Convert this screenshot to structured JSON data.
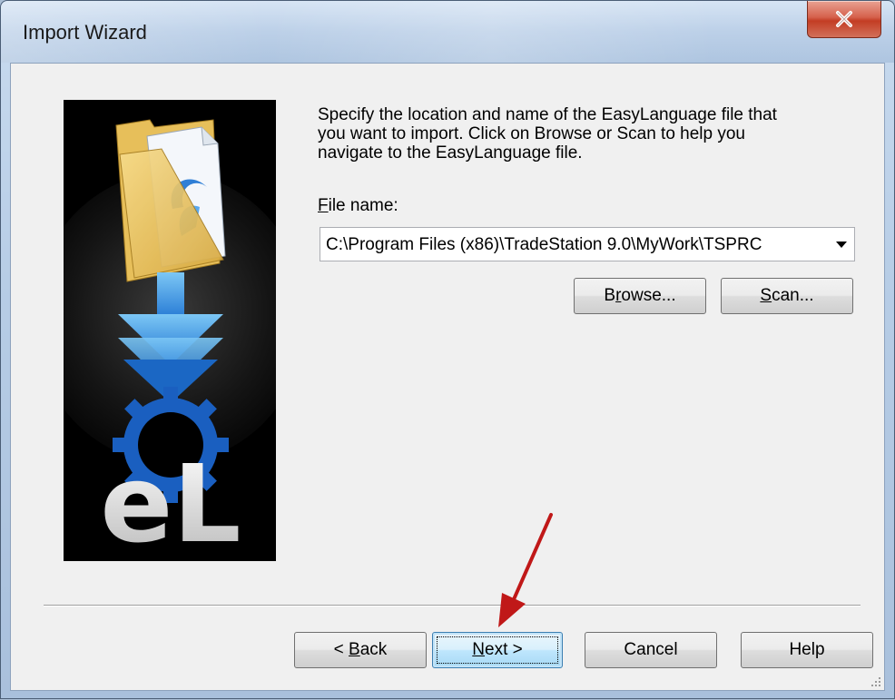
{
  "window": {
    "title": "Import Wizard"
  },
  "content": {
    "instructions": "Specify the location and name of the EasyLanguage file that\nyou want to import.  Click on Browse or Scan to help you\nnavigate to the EasyLanguage file.",
    "file_label_mnemonic": "F",
    "file_label_rest": "ile name:",
    "file_path": "C:\\Program Files (x86)\\TradeStation 9.0\\MyWork\\TSPRC"
  },
  "buttons": {
    "browse_pre": "B",
    "browse_mn": "r",
    "browse_post": "owse...",
    "scan_mn": "S",
    "scan_post": "can...",
    "back_pre": "< ",
    "back_mn": "B",
    "back_post": "ack",
    "next_mn": "N",
    "next_post": "ext >",
    "cancel": "Cancel",
    "help": "Help"
  },
  "image": {
    "logo_text": "eL"
  },
  "icons": {
    "close": "close-icon",
    "arrow": "red-arrow-annotation",
    "grip": "resize-grip-icon"
  },
  "colors": {
    "close_button": "#c33d24",
    "arrow": "#c01818",
    "default_button": "#3c7fb1"
  }
}
